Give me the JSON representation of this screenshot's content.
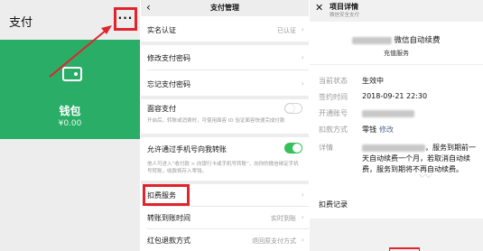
{
  "colors": {
    "accent_green": "#2aae67",
    "highlight_red": "#e0242c",
    "link_blue": "#576b95",
    "toggle_on": "#35c05b"
  },
  "pay": {
    "title": "支付",
    "more_icon": "more-dots-icon",
    "more_label": "···",
    "wallet_label": "钱包",
    "wallet_amount": "¥0.00"
  },
  "settings": {
    "back": "‹",
    "title": "支付管理",
    "verification": {
      "label": "实名认证",
      "value": "已认证"
    },
    "change_password": "修改支付密码",
    "forgot_password": "忘记支付密码",
    "face_pay": {
      "label": "面容支付",
      "enabled": false,
      "note": "开启后，转账或消费时，可使用面容 ID 验证面容快速完成付款"
    },
    "phone_transfer": {
      "label": "允许通过手机号向我转账",
      "enabled": true,
      "note": "他人可进入“收付款 > 向银行卡或手机号转账”，向你的微信绑定手机号转账，收款将存入零钱。"
    },
    "deduction_service": "扣费服务",
    "transfer_time": {
      "label": "转账到账时间",
      "value": "实时到账"
    },
    "red_packet_refund": {
      "label": "红包退款方式",
      "value": "退回原支付方式"
    }
  },
  "detail": {
    "close": "✕",
    "title": "项目详情",
    "subtitle": "微信安全支付",
    "heading": "微信自动续费",
    "service": "充值服务",
    "fields": [
      {
        "key": "当前状态",
        "value": "生效中"
      },
      {
        "key": "签约时间",
        "value": "2018-09-21 22:30"
      },
      {
        "key": "开通账号",
        "value": ""
      },
      {
        "key": "扣款方式",
        "value": "零钱"
      }
    ],
    "modify": "修改",
    "detail_key": "详情",
    "detail_text": "，服务到期前一天自动续费一个月，若取消自动续费，服务到期将不再自动续费。",
    "records": "扣费记录"
  }
}
